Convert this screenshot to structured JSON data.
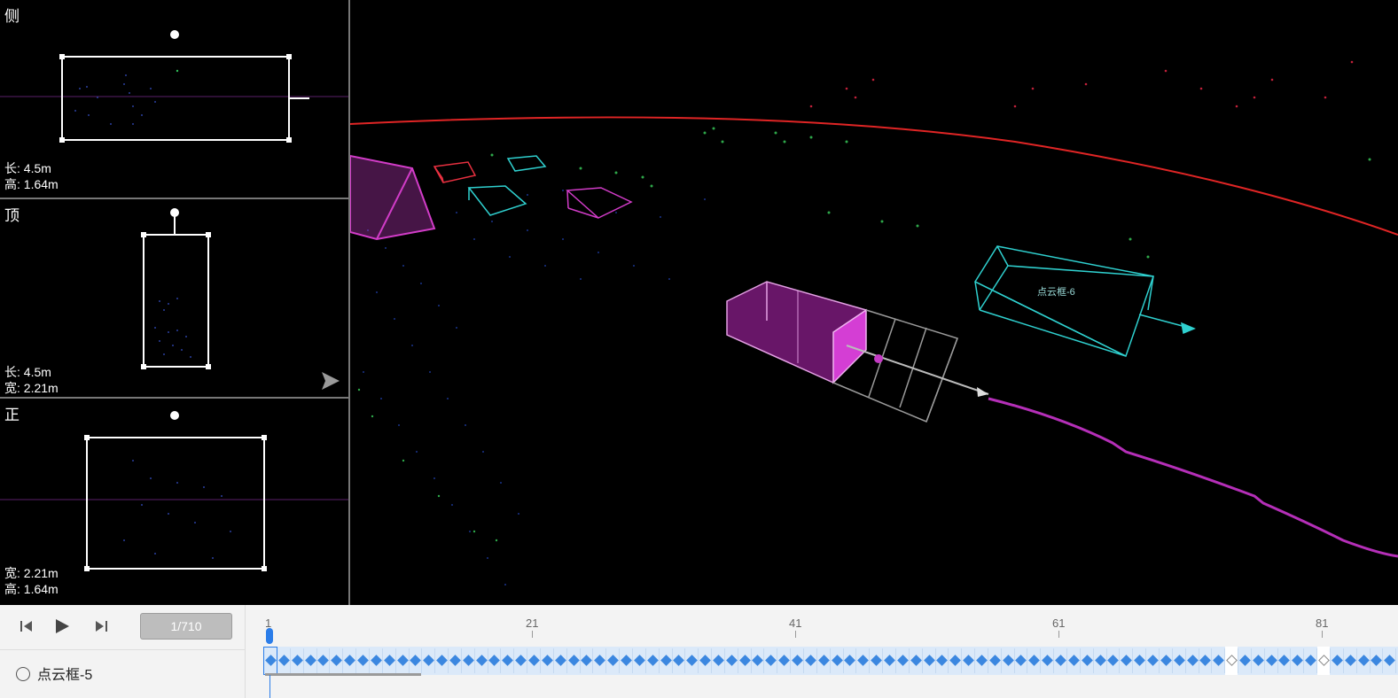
{
  "views": {
    "side": {
      "title": "侧",
      "dim1": "长: 4.5m",
      "dim2": "高: 1.64m"
    },
    "top": {
      "title": "顶",
      "dim1": "长: 4.5m",
      "dim2": "宽: 2.21m"
    },
    "front": {
      "title": "正",
      "dim1": "宽: 2.21m",
      "dim2": "高: 1.64m"
    }
  },
  "scene": {
    "box_label": "点云框-6"
  },
  "playback": {
    "prev_icon": "skip-previous-icon",
    "play_icon": "play-icon",
    "next_icon": "skip-next-icon",
    "frame_counter": "1/710"
  },
  "object": {
    "label": "点云框-5"
  },
  "timeline": {
    "ticks": [
      "1",
      "21",
      "41",
      "61",
      "81"
    ],
    "current_frame": "1",
    "empty_keyframes": [
      74,
      81
    ]
  },
  "colors": {
    "accent": "#2b7de9",
    "magenta": "#c43bc4",
    "cyan": "#2fd0cf",
    "red": "#e02525"
  }
}
